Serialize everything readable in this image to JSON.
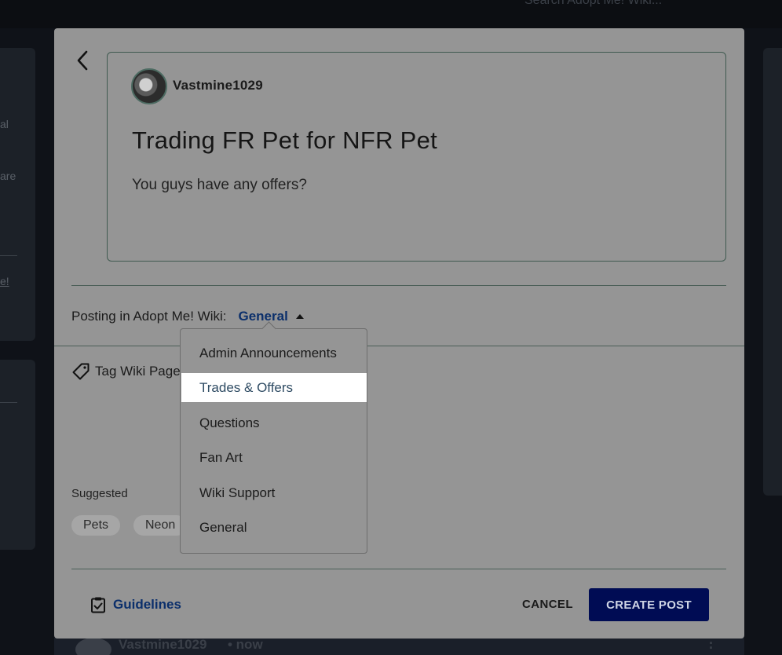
{
  "background": {
    "search_hint": "Search Adopt Me! Wiki...",
    "left_fragments": [
      "al",
      "are",
      "e!"
    ],
    "bottom_post": {
      "username": "Vastmine1029",
      "time": "• now"
    }
  },
  "modal": {
    "preview": {
      "username": "Vastmine1029",
      "title": "Trading FR Pet for NFR Pet",
      "body": "You guys have any offers?"
    },
    "posting": {
      "label": "Posting in Adopt Me! Wiki:",
      "selected_category": "General"
    },
    "category_dropdown": {
      "options": [
        "Admin Announcements",
        "Trades & Offers",
        "Questions",
        "Fan Art",
        "Wiki Support",
        "General"
      ],
      "highlighted": "Trades & Offers"
    },
    "tag": {
      "label": "Tag Wiki Pages"
    },
    "suggested": {
      "label": "Suggested",
      "chips": [
        "Pets",
        "Neon"
      ]
    },
    "footer": {
      "guidelines_label": "Guidelines",
      "cancel_label": "CANCEL",
      "create_label": "CREATE POST"
    }
  },
  "colors": {
    "accent_link": "#0b2f6b",
    "primary_button": "#000c54",
    "highlight": "#ffffff"
  }
}
